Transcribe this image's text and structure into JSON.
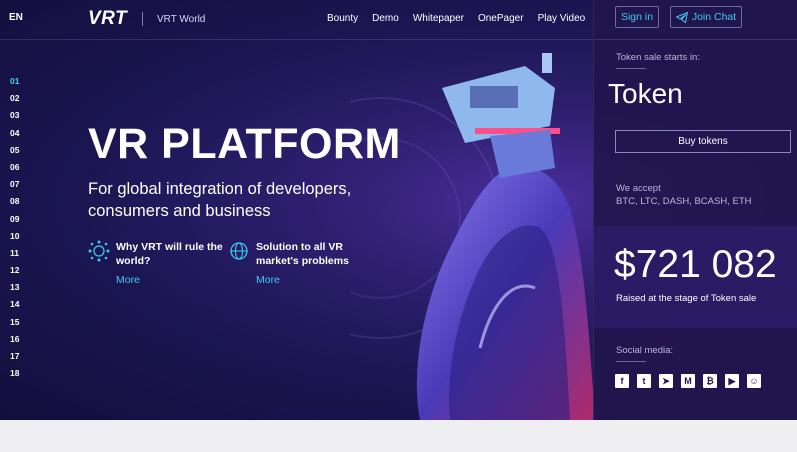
{
  "header": {
    "lang": "EN",
    "logo": "VRT",
    "logo_sub": "VRT World",
    "nav": [
      "Bounty",
      "Demo",
      "Whitepaper",
      "OnePager",
      "Play Video"
    ],
    "sign_in": "Sign in",
    "join_chat": "Join Chat"
  },
  "side_nav": [
    "01",
    "02",
    "03",
    "04",
    "05",
    "06",
    "07",
    "08",
    "09",
    "10",
    "11",
    "12",
    "13",
    "14",
    "15",
    "16",
    "17",
    "18"
  ],
  "hero": {
    "title": "VR PLATFORM",
    "subtitle": "For global integration of developers, consumers and business",
    "features": [
      {
        "text": "Why VRT will rule the world?",
        "more": "More",
        "icon": "network-globe-icon"
      },
      {
        "text": "Solution to all VR market's problems",
        "more": "More",
        "icon": "globe-icon"
      }
    ]
  },
  "panel": {
    "sale_label": "Token sale starts in:",
    "token": "Token",
    "buy": "Buy tokens",
    "accept_label": "We accept",
    "accept_list": "BTC, LTC, DASH, BCASH, ETH",
    "amount": "$721 082",
    "raised": "Raised at the stage of Token sale",
    "social_label": "Social media:",
    "socials": [
      "facebook-icon",
      "twitter-icon",
      "telegram-icon",
      "medium-icon",
      "bitcointalk-icon",
      "youtube-icon",
      "reddit-icon"
    ]
  },
  "colors": {
    "accent": "#3fc7ef",
    "active_num": "#3fd4f5",
    "panel_bg": "#22154e",
    "hero_bg": "#1b1652"
  }
}
